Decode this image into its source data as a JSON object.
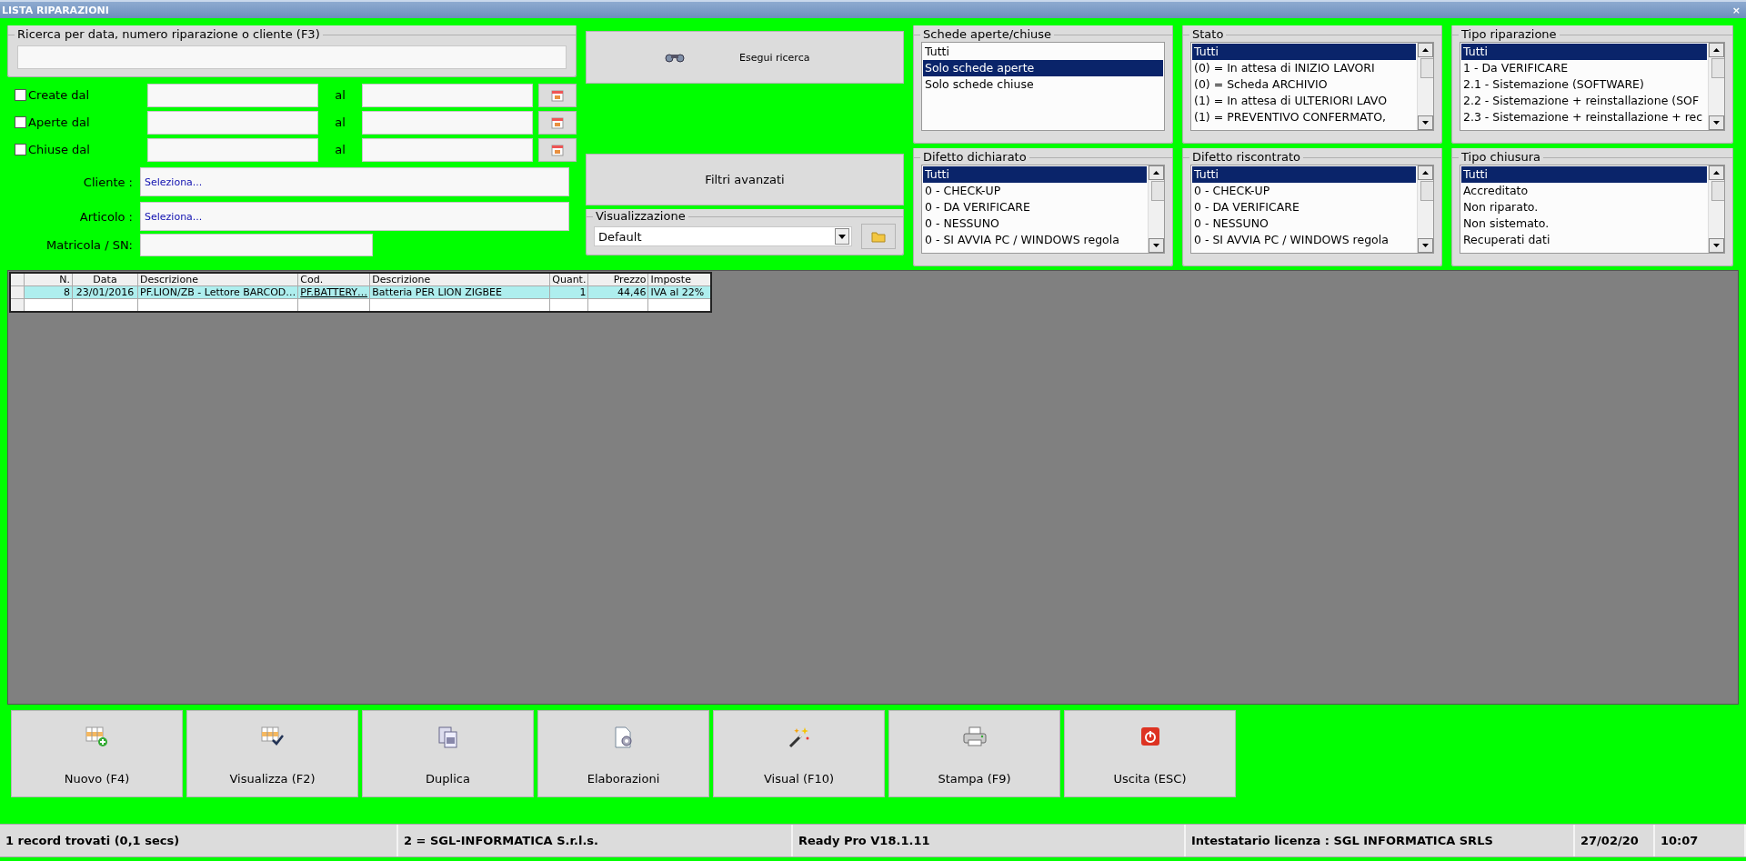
{
  "window": {
    "title": "LISTA RIPARAZIONI",
    "close": "×"
  },
  "search": {
    "legend": "Ricerca per data, numero riparazione o cliente (F3)"
  },
  "date_filters": [
    {
      "label": "Create dal",
      "checked": false,
      "to_label": "al"
    },
    {
      "label": "Aperte dal",
      "checked": false,
      "to_label": "al"
    },
    {
      "label": "Chiuse dal",
      "checked": false,
      "to_label": "al"
    }
  ],
  "lookups": [
    {
      "label": "Cliente :",
      "value": "Seleziona..."
    },
    {
      "label": "Articolo :",
      "value": "Seleziona..."
    }
  ],
  "serial": {
    "label": "Matricola / SN:"
  },
  "search_button": "Esegui ricerca",
  "advanced_button": "Filtri avanzati",
  "view": {
    "legend": "Visualizzazione",
    "value": "Default"
  },
  "lists": [
    {
      "title": "Schede aperte/chiuse",
      "scrollbar": false,
      "items": [
        {
          "label": "Tutti",
          "selected": false
        },
        {
          "label": "Solo schede aperte",
          "selected": true
        },
        {
          "label": "Solo schede chiuse",
          "selected": false
        }
      ]
    },
    {
      "title": "Stato",
      "scrollbar": true,
      "items": [
        {
          "label": "Tutti",
          "selected": true
        },
        {
          "label": "(0) = In attesa di INIZIO LAVORI",
          "selected": false
        },
        {
          "label": "(0) = Scheda ARCHIVIO",
          "selected": false
        },
        {
          "label": "(1) = In attesa di ULTERIORI LAVO",
          "selected": false
        },
        {
          "label": "(1) = PREVENTIVO CONFERMATO,",
          "selected": false
        }
      ]
    },
    {
      "title": "Tipo riparazione",
      "scrollbar": true,
      "items": [
        {
          "label": "Tutti",
          "selected": true
        },
        {
          "label": "1 - Da VERIFICARE",
          "selected": false
        },
        {
          "label": "2.1 - Sistemazione (SOFTWARE)",
          "selected": false
        },
        {
          "label": "2.2 - Sistemazione + reinstallazione (SOF",
          "selected": false
        },
        {
          "label": "2.3 - Sistemazione + reinstallazione + rec",
          "selected": false
        }
      ]
    },
    {
      "title": "Difetto dichiarato",
      "scrollbar": true,
      "items": [
        {
          "label": "Tutti",
          "selected": true
        },
        {
          "label": "0 - CHECK-UP",
          "selected": false
        },
        {
          "label": "0 - DA VERIFICARE",
          "selected": false
        },
        {
          "label": "0 - NESSUNO",
          "selected": false
        },
        {
          "label": "0 - SI AVVIA PC / WINDOWS regola",
          "selected": false
        }
      ]
    },
    {
      "title": "Difetto riscontrato",
      "scrollbar": true,
      "items": [
        {
          "label": "Tutti",
          "selected": true
        },
        {
          "label": "0 - CHECK-UP",
          "selected": false
        },
        {
          "label": "0 - DA VERIFICARE",
          "selected": false
        },
        {
          "label": "0 - NESSUNO",
          "selected": false
        },
        {
          "label": "0 - SI AVVIA PC / WINDOWS regola",
          "selected": false
        }
      ]
    },
    {
      "title": "Tipo chiusura",
      "scrollbar": true,
      "items": [
        {
          "label": "Tutti",
          "selected": true
        },
        {
          "label": "Accreditato",
          "selected": false
        },
        {
          "label": "Non riparato.",
          "selected": false
        },
        {
          "label": "Non sistemato.",
          "selected": false
        },
        {
          "label": "Recuperati dati",
          "selected": false
        }
      ]
    }
  ],
  "table": {
    "columns": [
      "N.",
      "Data",
      "Descrizione",
      "Cod.",
      "Descrizione",
      "Quant.",
      "Prezzo",
      "Imposte"
    ],
    "rows": [
      {
        "selected": true,
        "cells": [
          "8",
          "23/01/2016",
          "PF.LION/ZB - Lettore BARCOD…",
          "PF.BATTERY…",
          "Batteria PER LION ZIGBEE",
          "1",
          "44,46",
          "IVA al 22%"
        ]
      }
    ]
  },
  "actions": [
    {
      "label": "Nuovo (F4)",
      "kind": "new"
    },
    {
      "label": "Visualizza (F2)",
      "kind": "view"
    },
    {
      "label": "Duplica",
      "kind": "duplicate"
    },
    {
      "label": "Elaborazioni",
      "kind": "process"
    },
    {
      "label": "Visual (F10)",
      "kind": "wand"
    },
    {
      "label": "Stampa (F9)",
      "kind": "print"
    },
    {
      "label": "Uscita (ESC)",
      "kind": "exit"
    }
  ],
  "status_bar": [
    "1 record trovati (0,1 secs)",
    "2 = SGL-INFORMATICA S.r.l.s.",
    "Ready Pro V18.1.11",
    "Intestatario licenza : SGL INFORMATICA SRLS",
    "27/02/20",
    "10:07"
  ]
}
